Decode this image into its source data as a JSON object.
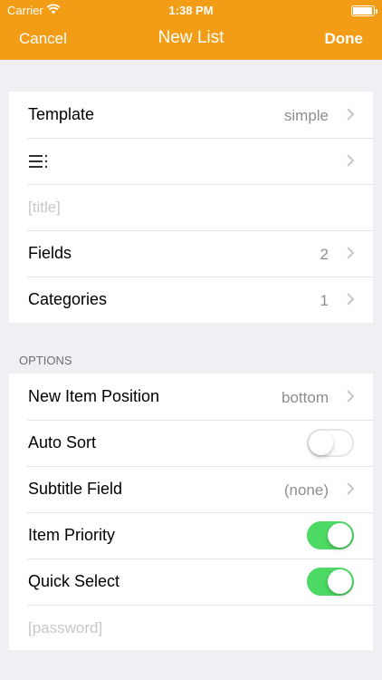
{
  "status_bar": {
    "carrier": "Carrier",
    "time": "1:38 PM"
  },
  "nav": {
    "title": "New List",
    "cancel_label": "Cancel",
    "done_label": "Done"
  },
  "colors": {
    "accent": "#f39c16",
    "switch_on": "#4cd964",
    "background": "#efeff4"
  },
  "group1": {
    "template_label": "Template",
    "template_value": "simple",
    "icon_name": "list-lines-icon",
    "title_placeholder": "[title]",
    "fields_label": "Fields",
    "fields_value": "2",
    "categories_label": "Categories",
    "categories_value": "1"
  },
  "options": {
    "header": "OPTIONS",
    "new_item_position_label": "New Item Position",
    "new_item_position_value": "bottom",
    "auto_sort_label": "Auto Sort",
    "auto_sort_on": false,
    "subtitle_field_label": "Subtitle Field",
    "subtitle_field_value": "(none)",
    "item_priority_label": "Item Priority",
    "item_priority_on": true,
    "quick_select_label": "Quick Select",
    "quick_select_on": true,
    "password_placeholder": "[password]"
  }
}
